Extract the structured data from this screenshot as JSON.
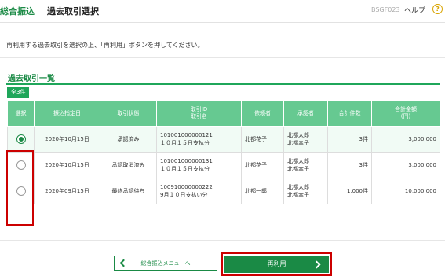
{
  "header": {
    "section": "総合振込",
    "title": "過去取引選択",
    "screen_id": "BSGF023",
    "help_label": "ヘルプ",
    "help_icon": "?"
  },
  "instruction": "再利用する過去取引を選択の上、「再利用」ボタンを押してください。",
  "list": {
    "title": "過去取引一覧",
    "count": "全3件",
    "columns": {
      "select": "選択",
      "date": "振込指定日",
      "status": "取引状態",
      "txn_id": "取引ID",
      "txn_name": "取引名",
      "requester": "依頼者",
      "approver": "承認者",
      "total_count": "合計件数",
      "total_amount": "合計金額",
      "total_amount_unit": "(円)"
    },
    "rows": [
      {
        "selected": true,
        "date": "2020年10月15日",
        "status": "承認済み",
        "txn_id": "101001000000121",
        "txn_name": "１０月１５日支払分",
        "requester": "北都花子",
        "approver1": "北都太郎",
        "approver2": "北都幸子",
        "total_count": "3件",
        "total_amount": "3,000,000"
      },
      {
        "selected": false,
        "date": "2020年10月15日",
        "status": "承認取消済み",
        "txn_id": "101001000000131",
        "txn_name": "１０月１５日支払分",
        "requester": "北都花子",
        "approver1": "北都太郎",
        "approver2": "北都幸子",
        "total_count": "3件",
        "total_amount": "3,000,000"
      },
      {
        "selected": false,
        "date": "2020年09月15日",
        "status": "最終承認待ち",
        "txn_id": "100910000000222",
        "txn_name": "9月１０日支払い分",
        "requester": "北都一郎",
        "approver1": "北都太郎",
        "approver2": "北都幸子",
        "total_count": "1,000件",
        "total_amount": "10,000,000"
      }
    ]
  },
  "buttons": {
    "back": "総合振込メニューへ",
    "reuse": "再利用"
  },
  "colors": {
    "brand_green": "#1a8a45",
    "header_green": "#66c991",
    "highlight_red": "#cc0000"
  }
}
